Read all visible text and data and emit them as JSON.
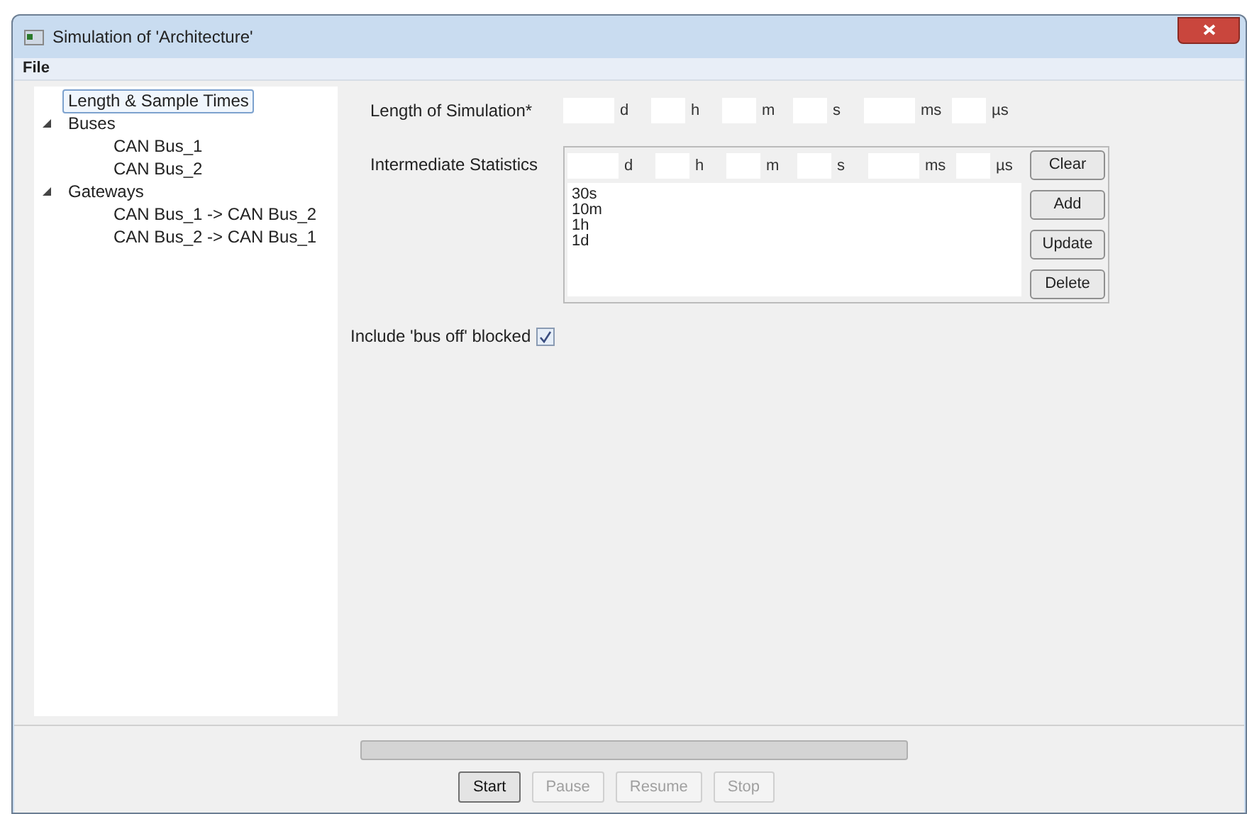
{
  "window": {
    "title": "Simulation of 'Architecture'"
  },
  "menu": [
    "File"
  ],
  "tree": [
    {
      "label": "Length & Sample Times",
      "selected": true,
      "expanded": false
    },
    {
      "label": "Buses",
      "selected": false,
      "expanded": true,
      "children": [
        {
          "label": "CAN Bus_1",
          "selected": false
        },
        {
          "label": "CAN Bus_2",
          "selected": false
        }
      ]
    },
    {
      "label": "Gateways",
      "selected": false,
      "expanded": true,
      "children": [
        {
          "label": "CAN Bus_1 -> CAN Bus_2",
          "selected": false
        },
        {
          "label": "CAN Bus_2 -> CAN Bus_1",
          "selected": false
        }
      ]
    }
  ],
  "length_of_simulation": {
    "label": "Length of Simulation*",
    "units": [
      "d",
      "h",
      "m",
      "s",
      "ms",
      "µs"
    ]
  },
  "intermediate_statistics": {
    "label": "Intermediate Statistics",
    "units": [
      "d",
      "h",
      "m",
      "s",
      "ms",
      "µs"
    ],
    "entries": [
      "30s",
      "10m",
      "1h",
      "1d"
    ],
    "buttons": [
      "Clear",
      "Add",
      "Update",
      "Delete"
    ]
  },
  "include_bus_off": {
    "label": "Include 'bus off' blocked",
    "checked": true
  },
  "progress": {
    "level": 0
  },
  "buttons": [
    {
      "label": "Start",
      "disabled": false
    },
    {
      "label": "Pause",
      "disabled": true
    },
    {
      "label": "Resume",
      "disabled": true
    },
    {
      "label": "Stop",
      "disabled": true
    }
  ]
}
